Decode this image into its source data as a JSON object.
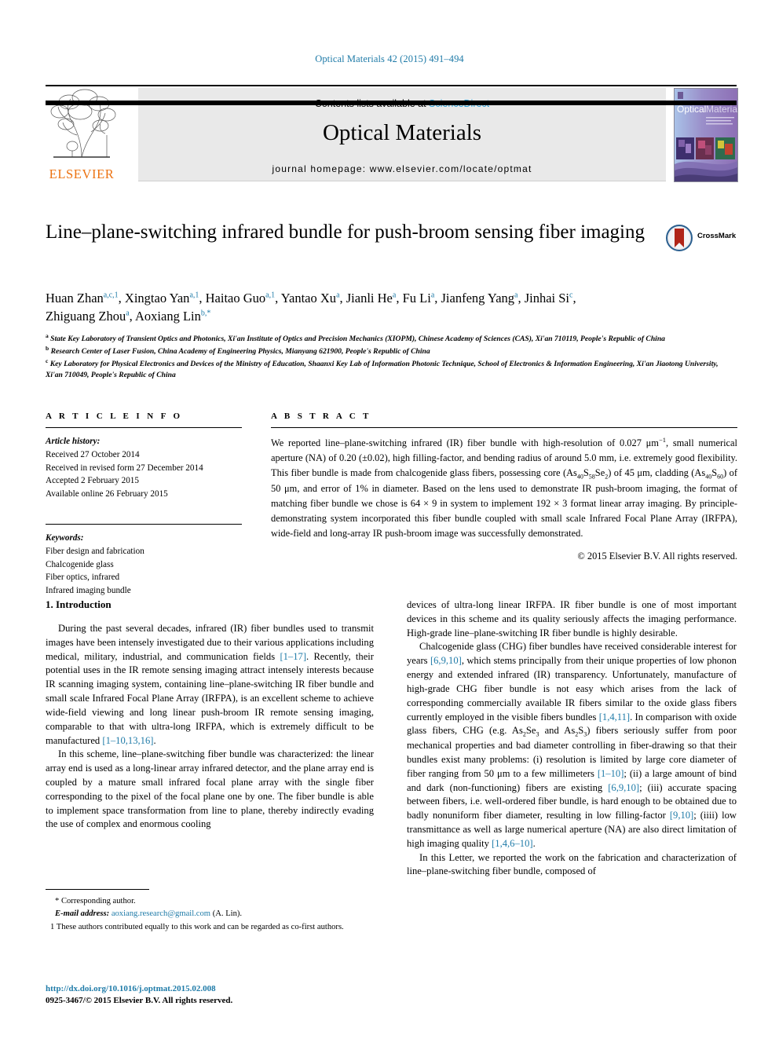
{
  "running_head": "Optical Materials 42 (2015) 491–494",
  "masthead": {
    "contents_prefix": "Contents lists available at ",
    "sciencedirect": "ScienceDirect",
    "journal_name": "Optical Materials",
    "homepage": "journal homepage: www.elsevier.com/locate/optmat",
    "publisher": "ELSEVIER",
    "cover_title_top": "Optical",
    "cover_title_bottom": "Materials"
  },
  "crossmark": {
    "label": "CrossMark"
  },
  "title": "Line–plane-switching infrared bundle for push-broom sensing fiber imaging",
  "authors_line1": "Huan Zhan a,c,1, Xingtao Yan a,1, Haitao Guo a,1, Yantao Xu a, Jianli He a, Fu Li a, Jianfeng Yang a, Jinhai Si c,",
  "authors_line2": "Zhiguang Zhou a, Aoxiang Lin b,*",
  "authors": [
    {
      "name": "Huan Zhan",
      "sup": "a,c,1"
    },
    {
      "name": "Xingtao Yan",
      "sup": "a,1"
    },
    {
      "name": "Haitao Guo",
      "sup": "a,1"
    },
    {
      "name": "Yantao Xu",
      "sup": "a"
    },
    {
      "name": "Jianli He",
      "sup": "a"
    },
    {
      "name": "Fu Li",
      "sup": "a"
    },
    {
      "name": "Jianfeng Yang",
      "sup": "a"
    },
    {
      "name": "Jinhai Si",
      "sup": "c"
    },
    {
      "name": "Zhiguang Zhou",
      "sup": "a"
    },
    {
      "name": "Aoxiang Lin",
      "sup": "b,*"
    }
  ],
  "affiliations": [
    {
      "mark": "a",
      "text": "State Key Laboratory of Transient Optics and Photonics, Xi'an Institute of Optics and Precision Mechanics (XIOPM), Chinese Academy of Sciences (CAS), Xi'an 710119, People's Republic of China"
    },
    {
      "mark": "b",
      "text": "Research Center of Laser Fusion, China Academy of Engineering Physics, Mianyang 621900, People's Republic of China"
    },
    {
      "mark": "c",
      "text": "Key Laboratory for Physical Electronics and Devices of the Ministry of Education, Shaanxi Key Lab of Information Photonic Technique, School of Electronics & Information Engineering, Xi'an Jiaotong University, Xi'an 710049, People's Republic of China"
    }
  ],
  "article_info": {
    "heading": "A R T I C L E   I N F O",
    "history_label": "Article history:",
    "history": [
      "Received 27 October 2014",
      "Received in revised form 27 December 2014",
      "Accepted 2 February 2015",
      "Available online 26 February 2015"
    ],
    "keywords_label": "Keywords:",
    "keywords": [
      "Fiber design and fabrication",
      "Chalcogenide glass",
      "Fiber optics, infrared",
      "Infrared imaging bundle"
    ]
  },
  "abstract": {
    "heading": "A B S T R A C T",
    "text_p1": "We reported line–plane-switching infrared (IR) fiber bundle with high-resolution of 0.027 ",
    "text_unit": "μm",
    "text_exp": "−1",
    "text_p2": ", small numerical aperture (NA) of 0.20 (±0.02), high filling-factor, and bending radius of around 5.0 mm, i.e. extremely good flexibility. This fiber bundle is made from chalcogenide glass fibers, possessing core (As",
    "sub1": "40",
    "text_p3": "S",
    "sub2": "58",
    "text_p4": "Se",
    "sub3": "2",
    "text_p5": ") of 45 μm, cladding (As",
    "sub4": "40",
    "text_p6": "S",
    "sub5": "60",
    "text_p7": ") of 50 μm, and error of 1% in diameter. Based on the lens used to demonstrate IR push-broom imaging, the format of matching fiber bundle we chose is 64 × 9 in system to implement 192 × 3 format linear array imaging. By principle-demonstrating system incorporated this fiber bundle coupled with small scale Infrared Focal Plane Array (IRFPA), wide-field and long-array IR push-broom image was successfully demonstrated.",
    "copyright": "© 2015 Elsevier B.V. All rights reserved."
  },
  "body": {
    "section1_heading": "1. Introduction",
    "left": {
      "p1_a": "During the past several decades, infrared (IR) fiber bundles used to transmit images have been intensely investigated due to their various applications including medical, military, industrial, and communication fields ",
      "p1_ref1": "[1–17]",
      "p1_b": ". Recently, their potential uses in the IR remote sensing imaging attract intensely interests because IR scanning imaging system, containing line–plane-switching IR fiber bundle and small scale Infrared Focal Plane Array (IRFPA), is an excellent scheme to achieve wide-field viewing and long linear push-broom IR remote sensing imaging, comparable to that with ultra-long IRFPA, which is extremely difficult to be manufactured ",
      "p1_ref2": "[1–10,13,16]",
      "p1_c": ".",
      "p2": "In this scheme, line–plane-switching fiber bundle was characterized: the linear array end is used as a long-linear array infrared detector, and the plane array end is coupled by a mature small infrared focal plane array with the single fiber corresponding to the pixel of the focal plane one by one. The fiber bundle is able to implement space transformation from line to plane, thereby indirectly evading the use of complex and enormous cooling"
    },
    "right": {
      "p0": "devices of ultra-long linear IRFPA. IR fiber bundle is one of most important devices in this scheme and its quality seriously affects the imaging performance. High-grade line–plane-switching IR fiber bundle is highly desirable.",
      "p1_a": "Chalcogenide glass (CHG) fiber bundles have received considerable interest for years ",
      "p1_ref1": "[6,9,10]",
      "p1_b": ", which stems principally from their unique properties of low phonon energy and extended infrared (IR) transparency. Unfortunately, manufacture of high-grade CHG fiber bundle is not easy which arises from the lack of corresponding commercially available IR fibers similar to the oxide glass fibers currently employed in the visible fibers bundles ",
      "p1_ref2": "[1,4,11]",
      "p1_c": ". In comparison with oxide glass fibers, CHG (e.g. As",
      "sub1": "2",
      "p1_d": "Se",
      "sub2": "3",
      "p1_e": " and As",
      "sub3": "2",
      "p1_f": "S",
      "sub4": "3",
      "p1_g": ") fibers seriously suffer from poor mechanical properties and bad diameter controlling in fiber-drawing so that their bundles exist many problems: (i) resolution is limited by large core diameter of fiber ranging from 50 μm to a few millimeters ",
      "p1_ref3": "[1–10]",
      "p1_h": "; (ii) a large amount of bind and dark (non-functioning) fibers are existing ",
      "p1_ref4": "[6,9,10]",
      "p1_i": "; (iii) accurate spacing between fibers, i.e. well-ordered fiber bundle, is hard enough to be obtained due to badly nonuniform fiber diameter, resulting in low filling-factor ",
      "p1_ref5": "[9,10]",
      "p1_j": "; (iiii) low transmittance as well as large numerical aperture (NA) are also direct limitation of high imaging quality ",
      "p1_ref6": "[1,4,6–10]",
      "p1_k": ".",
      "p2": "In this Letter, we reported the work on the fabrication and characterization of line–plane-switching fiber bundle, composed of"
    }
  },
  "footnotes": {
    "corresponding": "* Corresponding author.",
    "email_label": "E-mail address:",
    "email": "aoxiang.research@gmail.com",
    "email_suffix": "(A. Lin).",
    "equal_contrib": "1 These authors contributed equally to this work and can be regarded as co-first authors."
  },
  "footer": {
    "doi": "http://dx.doi.org/10.1016/j.optmat.2015.02.008",
    "issn_line": "0925-3467/© 2015 Elsevier B.V. All rights reserved."
  }
}
